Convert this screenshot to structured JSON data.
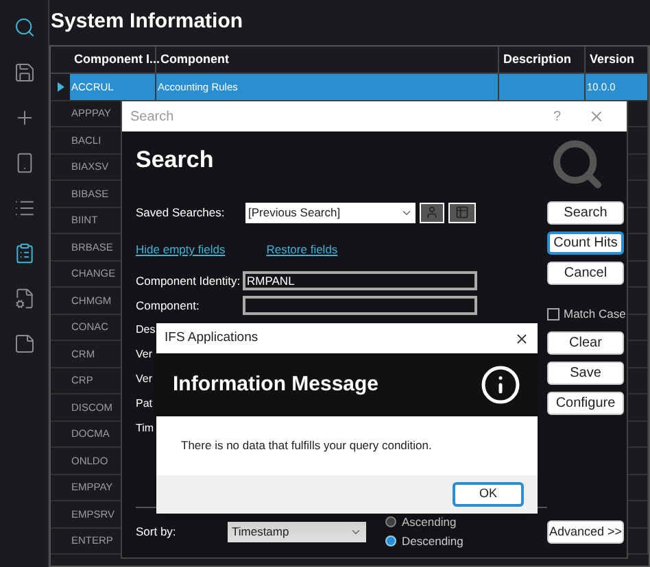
{
  "sidebar": {
    "items": [
      {
        "kind": "search",
        "selected": true
      },
      {
        "kind": "save",
        "selected": false
      },
      {
        "kind": "add",
        "selected": false
      },
      {
        "kind": "document",
        "selected": false
      },
      {
        "kind": "list",
        "selected": false
      },
      {
        "kind": "details",
        "selected": true
      },
      {
        "kind": "report",
        "selected": false
      },
      {
        "kind": "note",
        "selected": false
      }
    ]
  },
  "title": "System Information",
  "table": {
    "columns": [
      "Component I...",
      "Component",
      "Description",
      "Version"
    ],
    "rows": [
      {
        "cells": [
          "ACCRUL",
          "Accounting Rules",
          "",
          "10.0.0"
        ],
        "selected": true
      },
      {
        "cells": [
          "APPPAY"
        ],
        "selected": false
      },
      {
        "cells": [
          "BACLI"
        ],
        "selected": false
      },
      {
        "cells": [
          "BIAXSV"
        ],
        "selected": false
      },
      {
        "cells": [
          "BIBASE"
        ],
        "selected": false
      },
      {
        "cells": [
          "BIINT"
        ],
        "selected": false
      },
      {
        "cells": [
          "BRBASE"
        ],
        "selected": false
      },
      {
        "cells": [
          "CHANGE"
        ],
        "selected": false
      },
      {
        "cells": [
          "CHMGM"
        ],
        "selected": false
      },
      {
        "cells": [
          "CONAC"
        ],
        "selected": false
      },
      {
        "cells": [
          "CRM"
        ],
        "selected": false
      },
      {
        "cells": [
          "CRP"
        ],
        "selected": false
      },
      {
        "cells": [
          "DISCOM"
        ],
        "selected": false
      },
      {
        "cells": [
          "DOCMA"
        ],
        "selected": false
      },
      {
        "cells": [
          "ONLDO"
        ],
        "selected": false
      },
      {
        "cells": [
          "EMPPAY"
        ],
        "selected": false
      },
      {
        "cells": [
          "EMPSRV"
        ],
        "selected": false
      },
      {
        "cells": [
          "ENTERP"
        ],
        "selected": false
      }
    ]
  },
  "search_dialog": {
    "title": "Search",
    "help": "?",
    "heading": "Search",
    "saved_searches": {
      "label": "Saved Searches:",
      "value": "[Previous Search]"
    },
    "links": [
      "Hide empty fields",
      "Restore fields"
    ],
    "fields": [
      {
        "kind": "field",
        "label": "Component Identity:",
        "value": "RMPANL"
      },
      {
        "kind": "field",
        "label": "Component:"
      },
      {
        "kind": "label",
        "label": "Des"
      },
      {
        "kind": "label",
        "label": "Ver"
      },
      {
        "kind": "label",
        "label": "Ver"
      },
      {
        "kind": "label",
        "label": "Pat"
      },
      {
        "kind": "label",
        "label": "Tim"
      }
    ],
    "buttons_top": [
      {
        "label": "Search",
        "focused": false
      },
      {
        "label": "Count Hits",
        "focused": true
      },
      {
        "label": "Cancel",
        "focused": false
      }
    ],
    "match_case": {
      "label": "Match Case",
      "checked": false
    },
    "buttons_bottom": [
      {
        "label": "Clear",
        "focused": false
      },
      {
        "label": "Save",
        "focused": false
      },
      {
        "label": "Configure",
        "focused": false
      }
    ],
    "sort": {
      "label": "Sort by:",
      "value": "Timestamp",
      "options": [
        {
          "label": "Ascending",
          "selected": false
        },
        {
          "label": "Descending",
          "selected": true
        }
      ]
    },
    "advanced": "Advanced >>"
  },
  "info_dialog": {
    "title": "IFS Applications",
    "heading": "Information Message",
    "message": "There is no data that fulfills your query condition.",
    "ok": "OK"
  }
}
